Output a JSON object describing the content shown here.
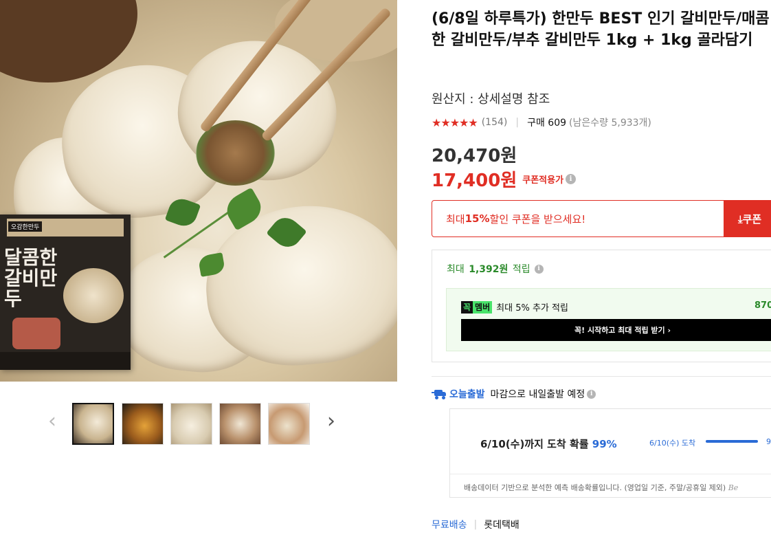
{
  "product": {
    "title": "(6/8일 하루특가) 한만두 BEST 인기 갈비만두/매콤한 갈비만두/부추 갈비만두 1kg + 1kg 골라담기",
    "origin": "원산지 : 상세설명 참조",
    "rating": {
      "stars": "★★★★★",
      "value": 4.5,
      "review_count": "(154)",
      "purchase": "구매 609",
      "remaining": "(남은수량 5,933개)"
    },
    "original_price": "20,470원",
    "sale_price": "17,400원",
    "coupon_label": "쿠폰적용가",
    "package_text": "달콤한 갈비만두",
    "package_brand": "오감한만두"
  },
  "gallery": {
    "thumbnails": [
      {
        "name": "thumbnail-1",
        "active": true
      },
      {
        "name": "thumbnail-2",
        "active": false
      },
      {
        "name": "thumbnail-3",
        "active": false
      },
      {
        "name": "thumbnail-4",
        "active": false
      },
      {
        "name": "thumbnail-5",
        "active": false
      }
    ],
    "prev_icon": "‹",
    "next_icon": "›"
  },
  "coupon": {
    "text_prefix": "최대 ",
    "text_bold": "15%",
    "text_suffix": " 할인 쿠폰을 받으세요!",
    "button_label": "⤓쿠폰"
  },
  "reward": {
    "title_prefix": "최대",
    "title_amount": "1,392원",
    "title_suffix": "적립",
    "member_badge_a": "꼭",
    "member_badge_b": "멤버",
    "member_text": "최대 5% 추가 적립",
    "member_amount": "870",
    "member_cta": "꼭! 시작하고 최대 적립 받기 ›"
  },
  "shipping": {
    "today_label": "오늘출발",
    "today_desc": "마감으로 내일출발 예정",
    "arrival_main": "6/10(수)까지 도착 확률",
    "arrival_pct": "99%",
    "arrival_side": "6/10(수) 도착",
    "arrival_bar_end": "9",
    "arrival_prob": 0.99,
    "arrival_note": "배송데이터 기반으로 분석한 예측 배송확률입니다. (영업일 기준, 주말/공휴일 제외)",
    "arrival_note_brand": "Be",
    "free_label": "무료배송",
    "carrier": "롯데택배"
  },
  "icons": {
    "info": "i",
    "truck": "truck-icon",
    "download": "download-icon"
  },
  "colors": {
    "accent_red": "#e02e24",
    "accent_blue": "#2a6bd6",
    "reward_green": "#2a8a2a",
    "member_green": "#49e36b"
  }
}
